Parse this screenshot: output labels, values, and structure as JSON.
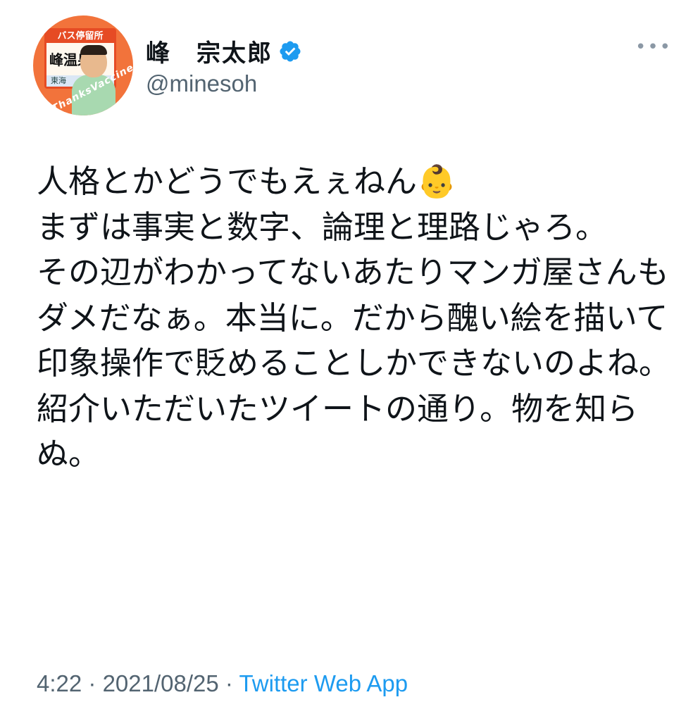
{
  "user": {
    "display_name": "峰　宗太郎",
    "handle": "@minesoh",
    "avatar": {
      "sign_top": "バス停留所",
      "sign_name": "峰温泉",
      "sign_bottom": "東海",
      "ring_text": "#ThanksVaccine"
    }
  },
  "tweet": {
    "text": "人格とかどうでもえぇねん👶\nまずは事実と数字、論理と理路じゃろ。\nその辺がわかってないあたりマンガ屋さんもダメだなぁ。本当に。だから醜い絵を描いて印象操作で貶めることしかできないのよね。紹介いただいたツイートの通り。物を知らぬ。"
  },
  "meta": {
    "time": "4:22",
    "sep1": " · ",
    "date": "2021/08/25",
    "sep2": " · ",
    "source": "Twitter Web App"
  },
  "icons": {
    "verified": "verified-badge-icon",
    "more": "more-icon"
  },
  "colors": {
    "verified": "#1d9bf0",
    "link": "#1d9bf0",
    "secondary": "#536471",
    "text": "#0f1419"
  }
}
